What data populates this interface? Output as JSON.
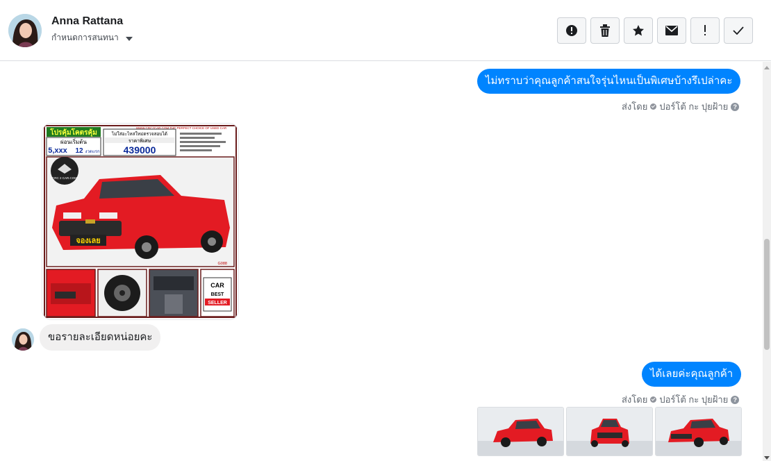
{
  "contact": {
    "name": "Anna Rattana",
    "subtitle": "กำหนดการสนทนา"
  },
  "toolbar": {
    "buttons": [
      "report-icon",
      "trash-icon",
      "star-icon",
      "mail-icon",
      "exclamation-icon",
      "check-icon"
    ]
  },
  "messages": {
    "outgoing_1": "ไม่ทราบว่าคุณลูกค้าสนใจรุ่นไหนเป็นพิเศษบ้างรึเปล่าคะ",
    "sentby_1": "ส่งโดย",
    "sender_1": "ปอร์โต้ กะ ปุยฝ้าย",
    "incoming_1": "ขอรายละเอียดหน่อยคะ",
    "outgoing_2": "ได้เลยค่ะคุณลูกค้า",
    "sentby_2": "ส่งโดย",
    "sender_2": "ปอร์โต้ กะ ปุยฝ้าย"
  },
  "ad_image": {
    "headline": "โปรคุ้มโคตรคุ้ม",
    "down_label": "ผ่อนเริ่มต้น",
    "down_value": "5,xxx",
    "term": "12",
    "term_unit": "งวดแรก",
    "site": "WWW.CRC2CAR.COM THE PERFECT CHOICE OF USED CAR",
    "banner": "ไม่ใส่อะไหล่ใหม่ตรวจสอบได้",
    "price_label": "ราคาพิเศษ",
    "price": "439000",
    "logo": "CRC 2 CAR.COM",
    "badge": "จองเลย",
    "code": "G088",
    "seller_1": "CAR",
    "seller_2": "BEST",
    "seller_3": "SELLER"
  },
  "colors": {
    "accent": "#0084ff",
    "car_red": "#e31b23",
    "incoming_bubble": "#f1f0f0"
  }
}
